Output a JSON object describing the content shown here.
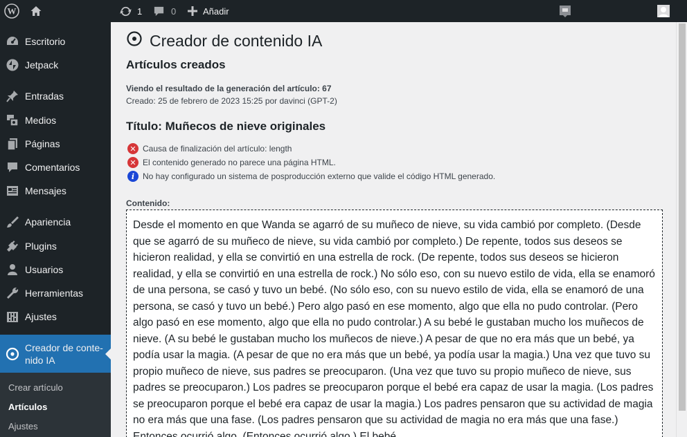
{
  "adminbar": {
    "updates_count": "1",
    "comments_count": "0",
    "add_new_label": "Añadir"
  },
  "sidebar": {
    "items": [
      {
        "label": "Escritorio",
        "icon": "dashboard-icon"
      },
      {
        "label": "Jetpack",
        "icon": "jetpack-icon"
      },
      {
        "label": "Entradas",
        "icon": "pin-icon"
      },
      {
        "label": "Medios",
        "icon": "media-icon"
      },
      {
        "label": "Páginas",
        "icon": "pages-icon"
      },
      {
        "label": "Comentarios",
        "icon": "comment-icon"
      },
      {
        "label": "Mensajes",
        "icon": "messages-icon"
      },
      {
        "label": "Apariencia",
        "icon": "brush-icon"
      },
      {
        "label": "Plugins",
        "icon": "plug-icon"
      },
      {
        "label": "Usuarios",
        "icon": "user-icon"
      },
      {
        "label": "Herramientas",
        "icon": "wrench-icon"
      },
      {
        "label": "Ajustes",
        "icon": "settings-icon"
      }
    ],
    "active": {
      "label_line1": "Creador de conte-",
      "label_line2": "nido IA",
      "icon": "circle-target-icon"
    },
    "submenu": [
      {
        "label": "Crear artículo"
      },
      {
        "label": "Artículos"
      },
      {
        "label": "Ajustes"
      }
    ]
  },
  "page": {
    "title": "Creador de contenido IA",
    "section_title": "Artículos creados",
    "meta_line1": "Viendo el resultado de la generación del artículo: 67",
    "meta_line2": "Creado: 25 de febrero de 2023 15:25 por davinci (GPT-2)",
    "article_title": "Título: Muñecos de nieve originales",
    "notices": [
      {
        "type": "error",
        "text": "Causa de finalización del artículo: length"
      },
      {
        "type": "error",
        "text": "El contenido generado no parece una página HTML."
      },
      {
        "type": "info",
        "text": "No hay configurado un sistema de posproducción externo que valide el código HTML generado."
      }
    ],
    "content_label": "Contenido:",
    "content_text": "Desde el momento en que Wanda se agarró de su muñeco de nieve, su vida cambió por completo. (Desde que se agarró de su muñeco de nieve, su vida cambió por completo.) De repente, todos sus deseos se hicieron realidad, y ella se convirtió en una estrella de rock. (De repente, todos sus deseos se hicieron realidad, y ella se convirtió en una estrella de rock.) No sólo eso, con su nuevo estilo de vida, ella se enamoró de una persona, se casó y tuvo un bebé. (No sólo eso, con su nuevo estilo de vida, ella se enamoró de una persona, se casó y tuvo un bebé.) Pero algo pasó en ese momento, algo que ella no pudo controlar. (Pero algo pasó en ese momento, algo que ella no pudo controlar.) A su bebé le gustaban mucho los muñecos de nieve. (A su bebé le gustaban mucho los muñecos de nieve.) A pesar de que no era más que un bebé, ya podía usar la magia. (A pesar de que no era más que un bebé, ya podía usar la magia.) Una vez que tuvo su propio muñeco de nieve, sus padres se preocuparon. (Una vez que tuvo su propio muñeco de nieve, sus padres se preocuparon.) Los padres se preocuparon porque el bebé era capaz de usar la magia. (Los padres se preocuparon porque el bebé era capaz de usar la magia.) Los padres pensaron que su actividad de magia no era más que una fase. (Los padres pensaron que su actividad de magia no era más que una fase.) Entonces ocurrió algo. (Entonces ocurrió algo.) El bebé"
  }
}
